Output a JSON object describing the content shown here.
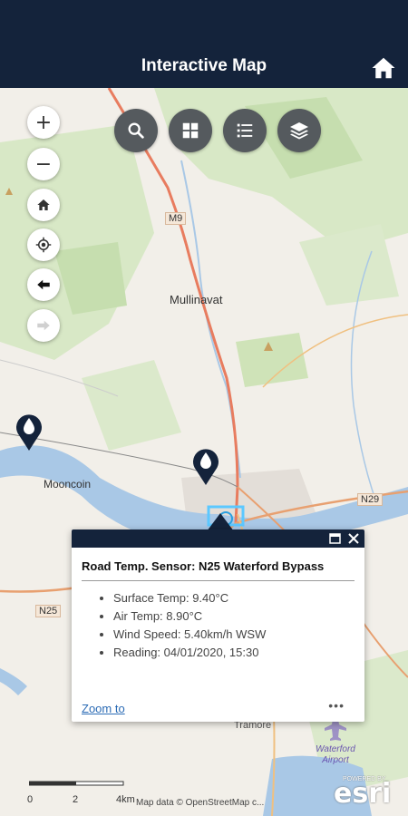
{
  "header": {
    "title": "Interactive Map"
  },
  "icons": {
    "home": "home-icon",
    "search": "search-icon",
    "basemap": "grid-icon",
    "legend": "list-icon",
    "layers": "layers-icon",
    "zoom_in": "plus-icon",
    "zoom_out": "minus-icon",
    "locate": "crosshair-icon",
    "back": "arrow-left-icon",
    "forward": "arrow-right-icon",
    "sensor": "water-drop-icon"
  },
  "zoom_controls": {
    "zoom_in": "+",
    "zoom_out": "−"
  },
  "map_labels": {
    "mullinavat": "Mullinavat",
    "mooncoin": "Mooncoin",
    "m9": "M9",
    "n25": "N25",
    "n29": "N29",
    "waterford_airport": "Waterford Airport",
    "tramore": "Tramore"
  },
  "popup": {
    "title": "Road Temp. Sensor: N25 Waterford Bypass",
    "items": [
      "Surface Temp: 9.40°C",
      "Air Temp: 8.90°C",
      "Wind Speed: 5.40km/h WSW",
      "Reading: 04/01/2020, 15:30"
    ],
    "zoom_to": "Zoom to",
    "more": "•••"
  },
  "scale": {
    "ticks": [
      "0",
      "2",
      "4km"
    ]
  },
  "attribution": "Map data © OpenStreetMap c...",
  "brand": {
    "powered_by": "POWERED BY",
    "name": "esri"
  },
  "colors": {
    "header": "#14233b",
    "tool": "#555a5e",
    "link": "#2b6bb5",
    "water": "#a9c8e6",
    "forest": "#cfe3b8",
    "road": "#e87c5f"
  }
}
